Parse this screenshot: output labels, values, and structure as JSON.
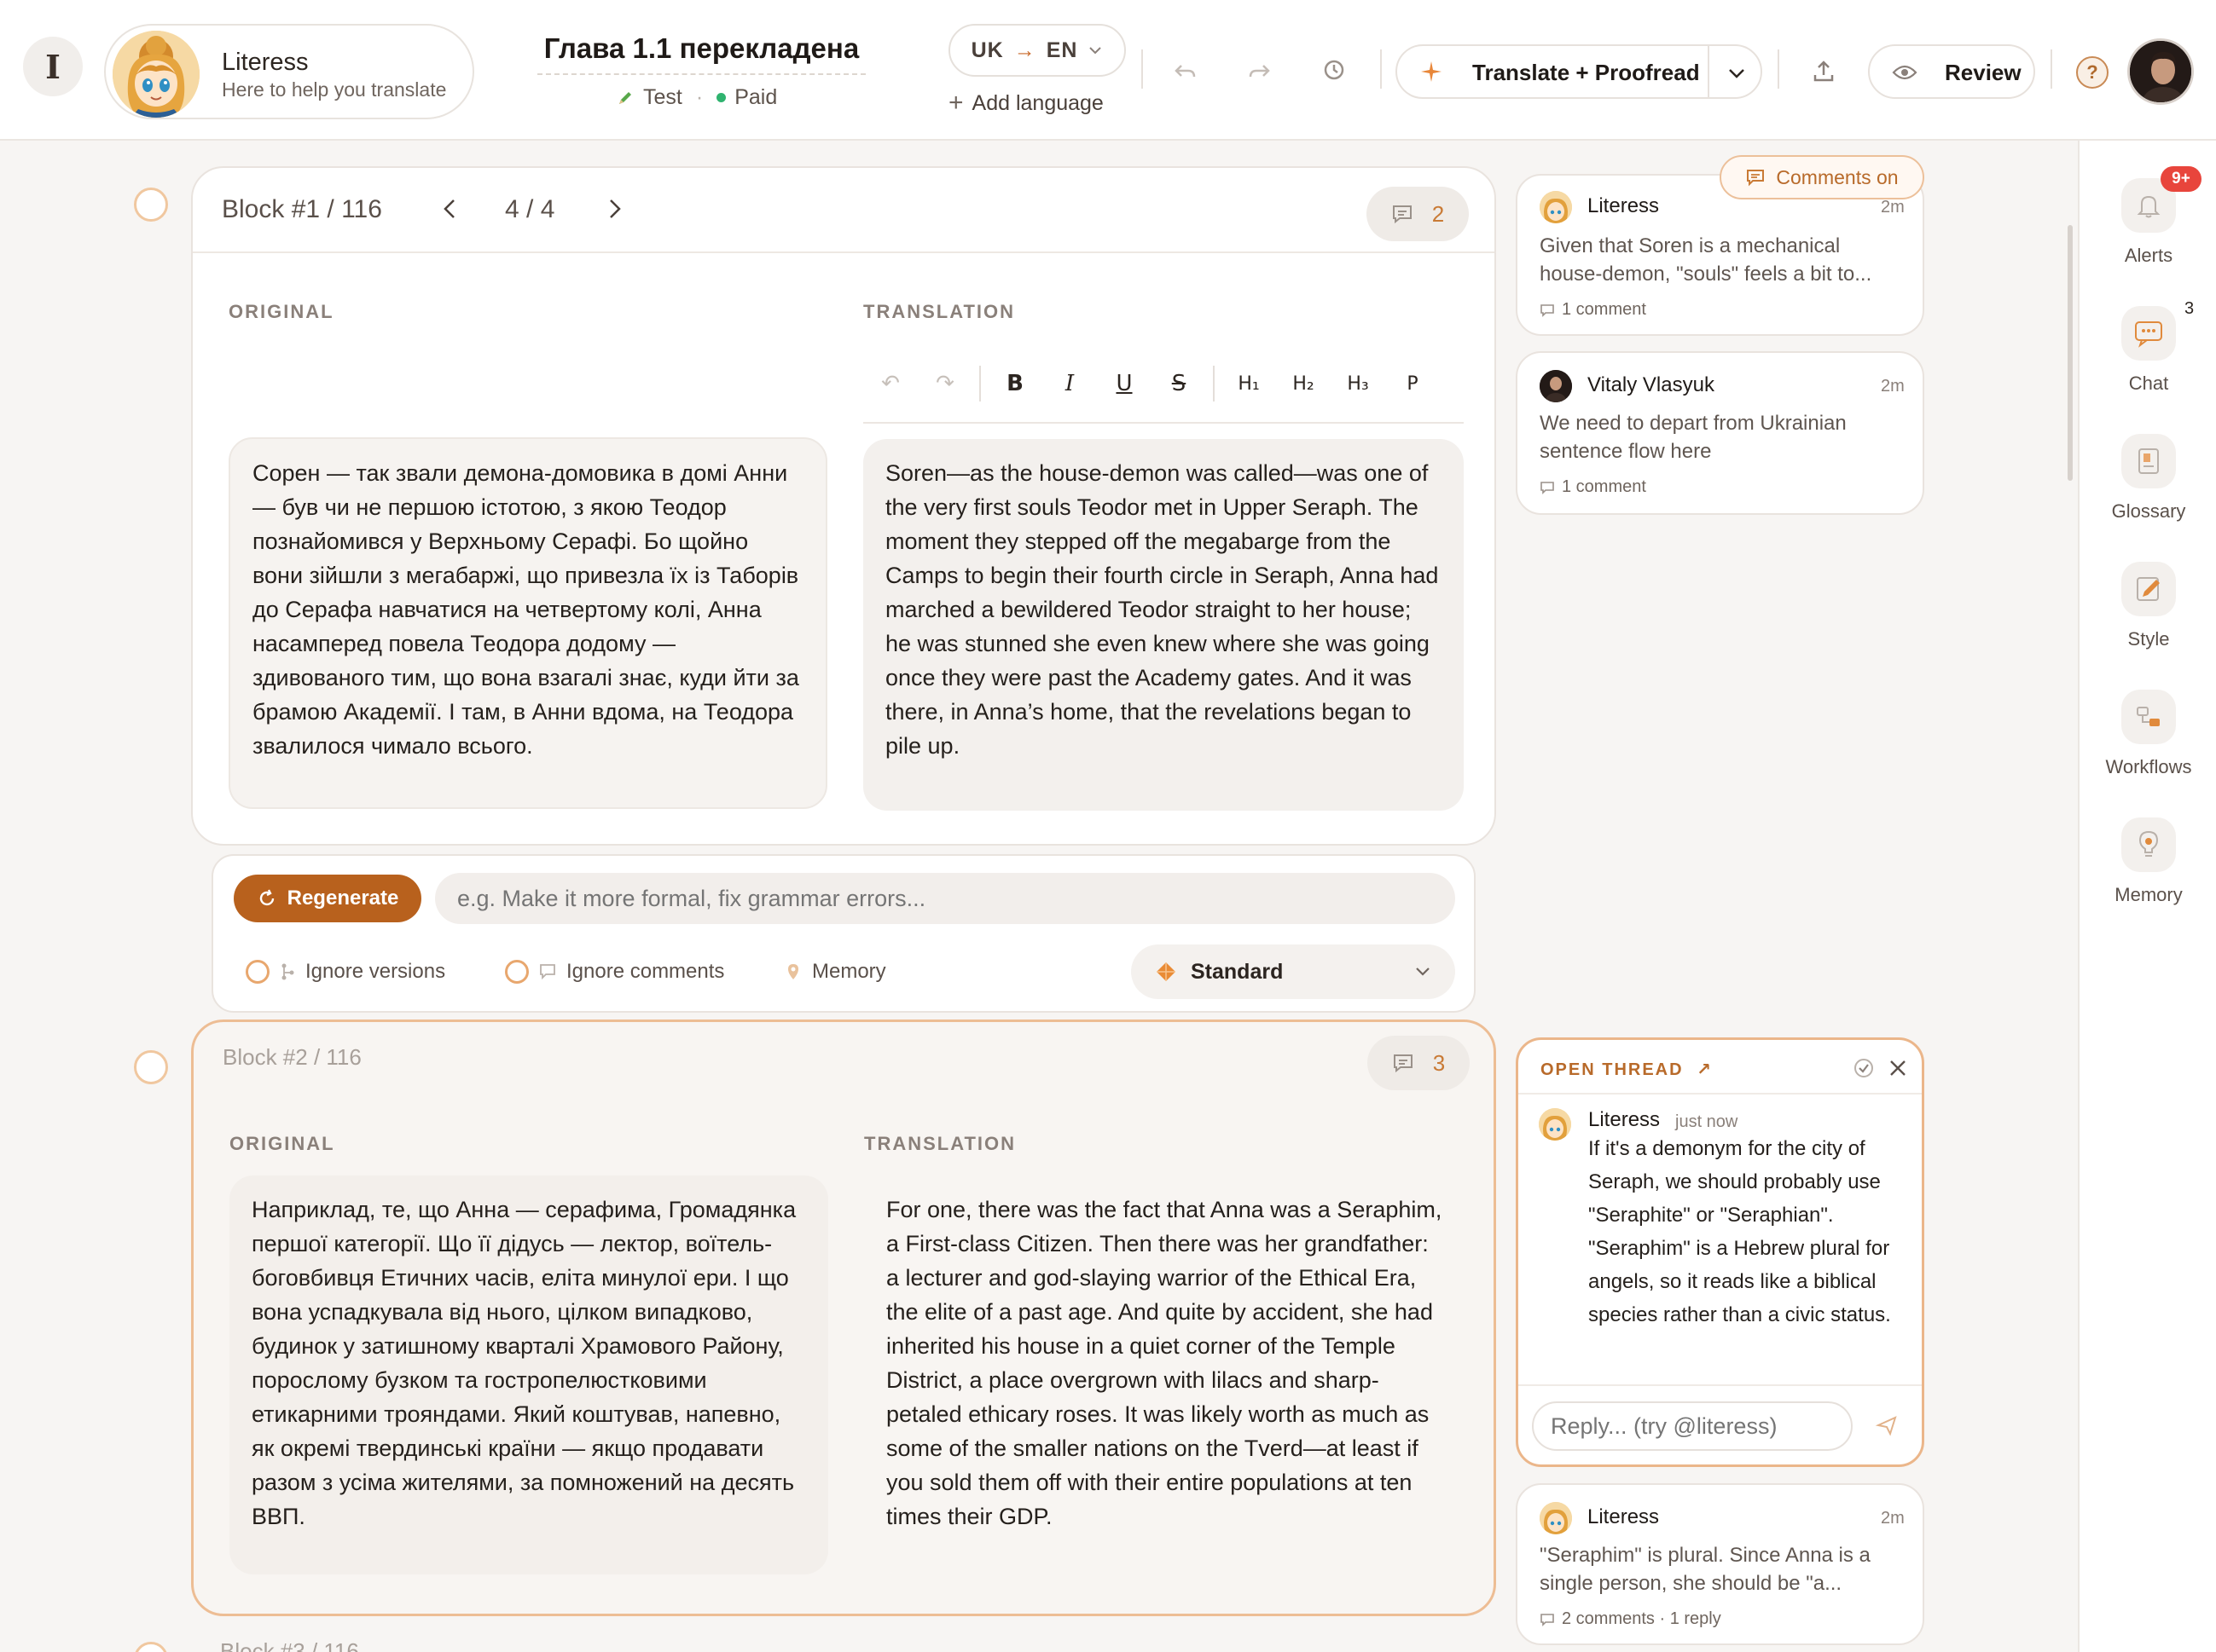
{
  "header": {
    "assistant": {
      "name": "Literess",
      "subtitle": "Here to help you translate"
    },
    "doc_title": "Глава 1.1 перекладена",
    "tags": {
      "test": "Test",
      "paid": "Paid",
      "separator": "·"
    },
    "lang": {
      "source": "UK",
      "target": "EN"
    },
    "add_language": "Add language",
    "translate_label": "Translate + Proofread",
    "review_label": "Review",
    "help": "?"
  },
  "blocks": [
    {
      "title": "Block #1 / 116",
      "pager": "4 / 4",
      "comment_count": "2",
      "original_label": "ORIGINAL",
      "translation_label": "TRANSLATION",
      "original": "Сорен — так звали демона-домовика в домі Анни — був чи не першою істотою, з якою Теодор познайомився у Верхньому Серафі. Бо щойно вони зійшли з мегабаржі, що привезла їх із Таборів до Серафа навчатися на четвертому колі, Анна насамперед повела Теодора додому — здивованого тим, що вона взагалі знає, куди йти за брамою Академії. І там, в Анни вдома, на Теодора звалилося чимало всього.",
      "translation": "Soren—as the house-demon was called—was one of the very first souls Teodor met in Upper Seraph. The moment they stepped off the megabarge from the Camps to begin their fourth circle in Seraph, Anna had marched a bewildered Teodor straight to her house; he was stunned she even knew where she was going once they were past the Academy gates. And it was there, in Anna’s home, that the revelations began to pile up.",
      "toolbar": [
        "↶",
        "↷",
        "B",
        "I",
        "U",
        "S",
        "H₁",
        "H₂",
        "H₃",
        "P"
      ]
    },
    {
      "title": "Block #2 / 116",
      "comment_count": "3",
      "original_label": "ORIGINAL",
      "translation_label": "TRANSLATION",
      "original": "Наприклад, те, що Анна — серафима, Громадянка першої категорії. Що її дідусь — лектор, воїтель-боговбивця Етичних часів, еліта минулої ери. І що вона успадкувала від нього, цілком випадково, будинок у затишному кварталі Храмового Району, порослому бузком та гостропелюстковими етикарними трояндами. Який коштував, напевно, як окремі твердинські країни — якщо продавати разом з усіма жителями, за помножений на десять ВВП.",
      "translation": "For one, there was the fact that Anna was a Seraphim, a First-class Citizen. Then there was her grandfather: a lecturer and god-slaying warrior of the Ethical Era, the elite of a past age. And quite by accident, she had inherited his house in a quiet corner of the Temple District, a place overgrown with lilacs and sharp-petaled ethicary roses. It was likely worth as much as some of the smaller nations on the Tverd—at least if you sold them off with their entire populations at ten times their GDP."
    },
    {
      "title": "Block #3 / 116"
    }
  ],
  "regenerate": {
    "button": "Regenerate",
    "placeholder": "e.g. Make it more formal, fix grammar errors...",
    "options": [
      "Ignore versions",
      "Ignore comments",
      "Memory"
    ],
    "mode": "Standard"
  },
  "comments": {
    "toggle": "Comments on",
    "cards": [
      {
        "author": "Literess",
        "time": "2m",
        "text": "Given that Soren is a mechanical house-demon, \"souls\" feels a bit to...",
        "meta": "1 comment"
      },
      {
        "author": "Vitaly Vlasyuk",
        "time": "2m",
        "text": "We need to depart from Ukrainian sentence flow here",
        "meta": "1 comment"
      },
      {
        "author": "Literess",
        "time": "2m",
        "text": "\"Seraphim\" is plural. Since Anna is a single person, she should be \"a...",
        "meta": "2 comments · 1 reply"
      }
    ],
    "thread": {
      "label": "OPEN THREAD",
      "author": "Literess",
      "time": "just now",
      "text": "If it's a demonym for the city of Seraph, we should probably use \"Seraphite\" or \"Seraphian\". \"Seraphim\" is a Hebrew plural for angels, so it reads like a biblical species rather than a civic status.",
      "reply_placeholder": "Reply... (try @literess)"
    }
  },
  "rail": {
    "items": [
      {
        "label": "Alerts",
        "badge": "9+"
      },
      {
        "label": "Chat",
        "count": "3"
      },
      {
        "label": "Glossary"
      },
      {
        "label": "Style"
      },
      {
        "label": "Workflows"
      },
      {
        "label": "Memory"
      }
    ]
  },
  "colors": {
    "accent": "#b8611d",
    "accent_light": "#edbd94",
    "badge_red": "#e8453c",
    "paid_green": "#2fb36f"
  }
}
